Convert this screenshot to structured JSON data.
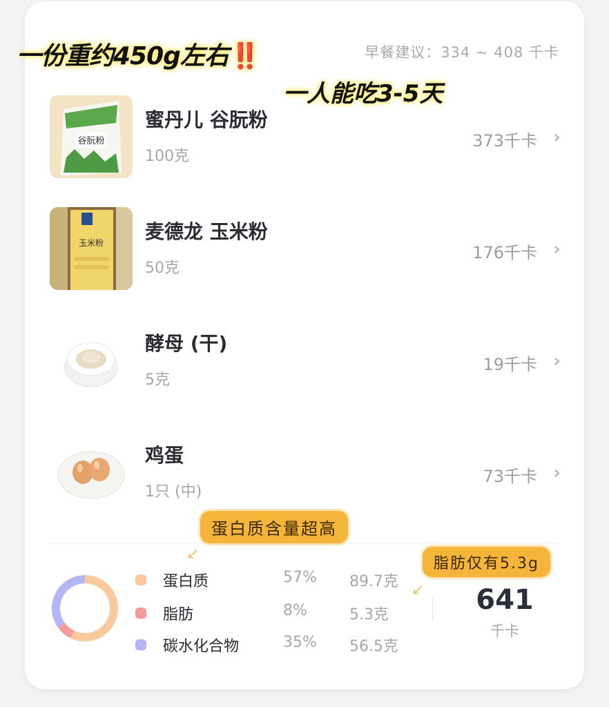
{
  "header": {
    "suggestion": "早餐建议：334 ~ 408 千卡"
  },
  "overlays": {
    "line1": "一份重约450g左右",
    "line1_mark": "‼️",
    "line2": "一人能吃3-5天",
    "protein_tag": "蛋白质含量超高",
    "fat_tag": "脂肪仅有5.3g"
  },
  "foods": [
    {
      "name": "蜜丹儿 谷朊粉",
      "amount": "100克",
      "calories": "373千卡",
      "icon": "flour-bag-icon",
      "package_text": "谷朊粉"
    },
    {
      "name": "麦德龙 玉米粉",
      "amount": "50克",
      "calories": "176千卡",
      "icon": "cornmeal-bag-icon",
      "package_text": "玉米粉"
    },
    {
      "name": "酵母 (干)",
      "amount": "5克",
      "calories": "19千卡",
      "icon": "yeast-bowl-icon"
    },
    {
      "name": "鸡蛋",
      "amount": "1只 (中)",
      "calories": "73千卡",
      "icon": "eggs-plate-icon"
    }
  ],
  "nutrition": {
    "items": [
      {
        "name": "蛋白质",
        "percent": "57%",
        "amount": "89.7克",
        "color": "#fbc99e",
        "fraction": 0.57
      },
      {
        "name": "脂肪",
        "percent": "8%",
        "amount": "5.3克",
        "color": "#f59a9a",
        "fraction": 0.08
      },
      {
        "name": "碳水化合物",
        "percent": "35%",
        "amount": "56.5克",
        "color": "#b3b5f5",
        "fraction": 0.35
      }
    ],
    "total_value": "641",
    "total_unit": "千卡"
  },
  "icons": {
    "chevron": "chevron-right-icon"
  }
}
